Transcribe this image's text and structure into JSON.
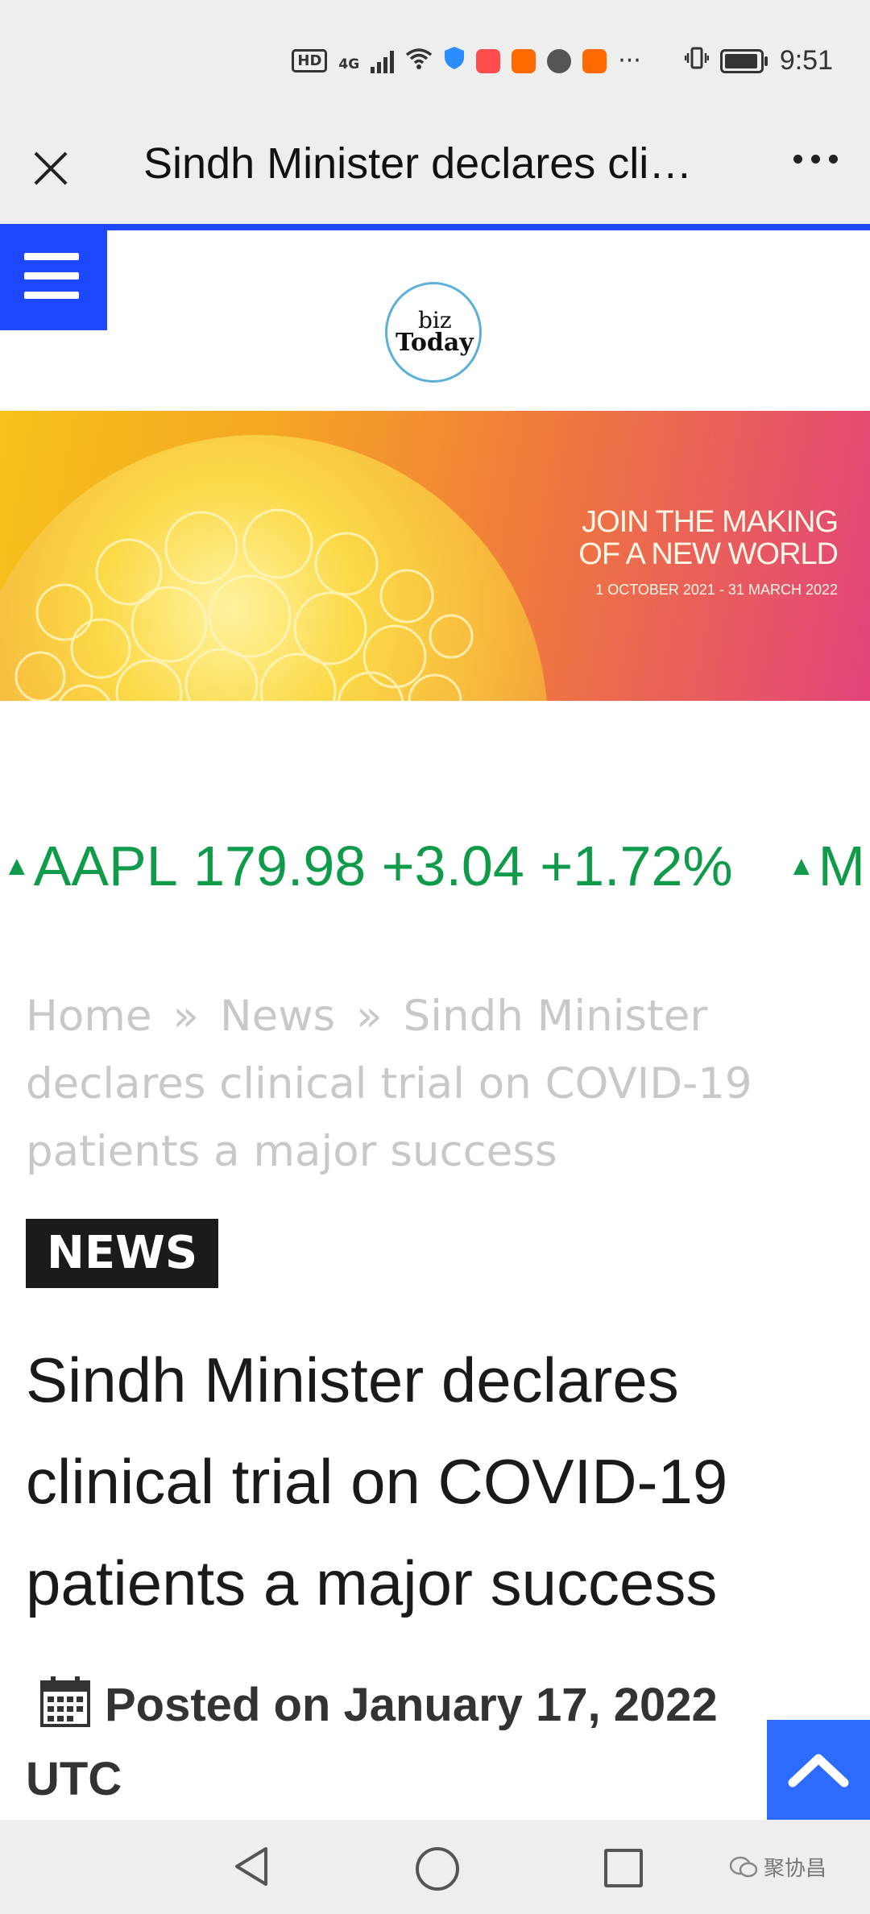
{
  "status_bar": {
    "time": "9:51",
    "hd_label": "HD",
    "network_label": "4G",
    "overflow_dots": "···"
  },
  "toolbar": {
    "title": "Sindh Minister declares cli…"
  },
  "logo": {
    "line1": "biz",
    "line2": "Today"
  },
  "banner": {
    "headline_line1": "JOIN THE MAKING",
    "headline_line2": "OF A NEW WORLD",
    "dates": "1 OCTOBER 2021 - 31 MARCH 2022"
  },
  "ticker": {
    "items": [
      {
        "symbol": "AAPL",
        "price": "179.98",
        "change": "+3.04",
        "percent": "+1.72%"
      },
      {
        "symbol": "M"
      }
    ],
    "up_color": "#0f9b4a"
  },
  "breadcrumb": {
    "home": "Home",
    "news": "News",
    "current": "Sindh Minister declares clinical trial on COVID-19 patients a major success",
    "separator": "»"
  },
  "article": {
    "category": "NEWS",
    "title": "Sindh Minister declares clinical trial on COVID-19 patients a major success",
    "posted_label": "Posted on January 17, 2022 UTC"
  },
  "watermark": {
    "text": "聚协昌"
  },
  "colors": {
    "accent_blue": "#1d48ff",
    "scroll_top_blue": "#2d6bff"
  }
}
